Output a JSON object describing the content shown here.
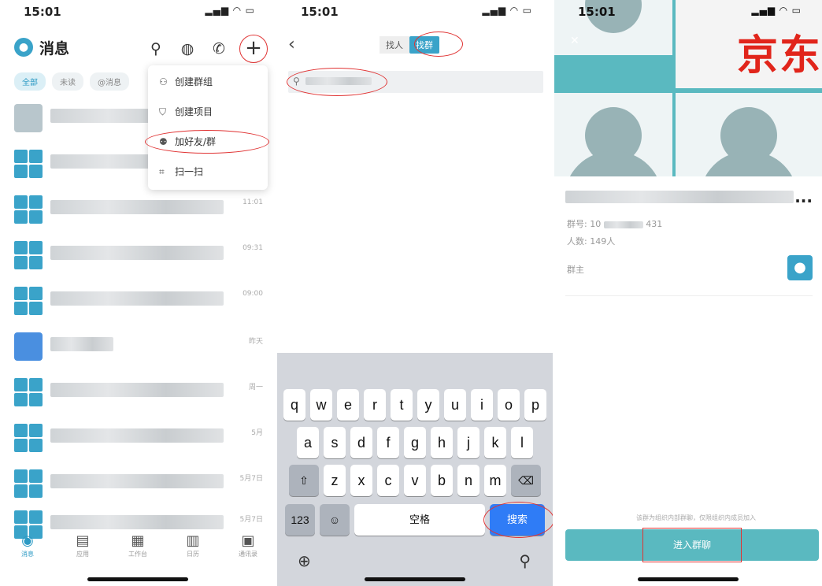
{
  "status": {
    "time": "15:01"
  },
  "messages_screen": {
    "title": "消息",
    "filters": [
      "全部",
      "未读",
      "@消息"
    ],
    "menu": [
      {
        "icon": "group-icon",
        "label": "创建群组"
      },
      {
        "icon": "shield-icon",
        "label": "创建项目"
      },
      {
        "icon": "add-friend-icon",
        "label": "加好友/群"
      },
      {
        "icon": "scan-icon",
        "label": "扫一扫"
      }
    ],
    "rows": [
      {
        "time": ""
      },
      {
        "time": ""
      },
      {
        "time": "11:01"
      },
      {
        "time": "09:31"
      },
      {
        "time": "09:00"
      },
      {
        "time": "昨天"
      },
      {
        "time": "周一"
      },
      {
        "time": "5月"
      },
      {
        "time": "5月7日"
      },
      {
        "time": "5月7日"
      }
    ],
    "tabs": [
      "消息",
      "应用",
      "工作台",
      "日历",
      "通讯录"
    ]
  },
  "search_screen": {
    "back": "‹",
    "segments": [
      "找人",
      "找群"
    ],
    "keyboard": {
      "row1": [
        "q",
        "w",
        "e",
        "r",
        "t",
        "y",
        "u",
        "i",
        "o",
        "p"
      ],
      "row2": [
        "a",
        "s",
        "d",
        "f",
        "g",
        "h",
        "j",
        "k",
        "l"
      ],
      "row3": [
        "z",
        "x",
        "c",
        "v",
        "b",
        "n",
        "m"
      ],
      "shift": "⇧",
      "delete": "⌫",
      "numbers": "123",
      "emoji": "☺",
      "space": "空格",
      "search": "搜索"
    }
  },
  "group_screen": {
    "cover_text": "京东",
    "ellipsis": "...",
    "group_no_label": "群号: 10",
    "group_no_tail": "431",
    "members": "人数: 149人",
    "owner_label": "群主",
    "notice": "该群为组织内部群聊，仅限组织内成员加入",
    "join": "进入群聊"
  }
}
